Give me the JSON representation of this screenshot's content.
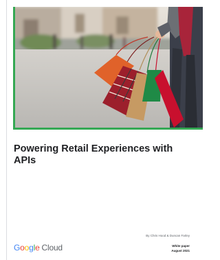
{
  "document": {
    "title": "Powering Retail Experiences with APIs",
    "authors": "By Chris Hood & Duncan Farley",
    "doc_type": "White paper",
    "date": "August 2021"
  },
  "brand": {
    "logo_letters": [
      "G",
      "o",
      "o",
      "g",
      "l",
      "e"
    ],
    "logo_word_cloud": "Cloud",
    "colors": {
      "blue": "#4285f4",
      "red": "#ea4335",
      "yellow": "#fbbc05",
      "green": "#34a853",
      "accent_border": "#34a853"
    }
  },
  "hero_image": {
    "subject": "shopper-holding-shopping-bags-photo"
  }
}
